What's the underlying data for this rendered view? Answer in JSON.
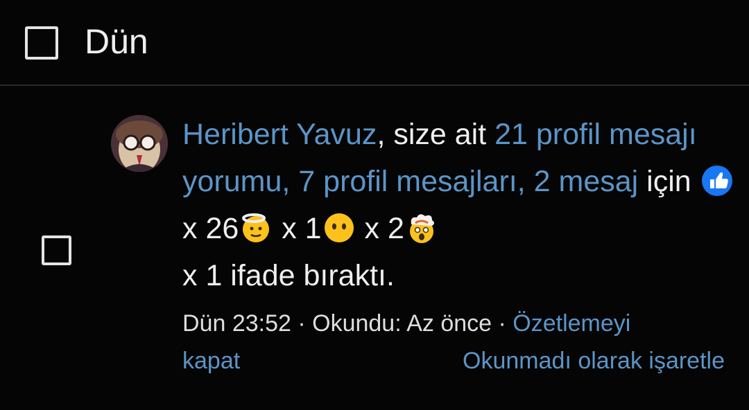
{
  "header": {
    "title": "Dün"
  },
  "alert": {
    "user": "Heribert Yavuz",
    "text_1": ", size ait ",
    "link_1": "21 profil mesajı yorumu",
    "sep_1": ", ",
    "link_2": "7 profil mesajları",
    "sep_2": ", ",
    "link_3": "2 mesaj",
    "text_2": " için ",
    "reactions": [
      {
        "icon": "like-icon",
        "count": " x 26"
      },
      {
        "icon": "innocent-face-icon",
        "count": " x 1"
      },
      {
        "icon": "no-mouth-face-icon",
        "count": " x 2"
      },
      {
        "icon": "exploding-head-icon",
        "count": ""
      }
    ],
    "text_3": "x 1 ifade bıraktı.",
    "meta": {
      "time": "Dün 23:52",
      "sep": " · ",
      "read_label": "Okundu: Az önce",
      "sep2": " · ",
      "collapse_link": "Özetlemeyi kapat",
      "mark_unread_link": "Okunmadı olarak işaretle"
    }
  }
}
